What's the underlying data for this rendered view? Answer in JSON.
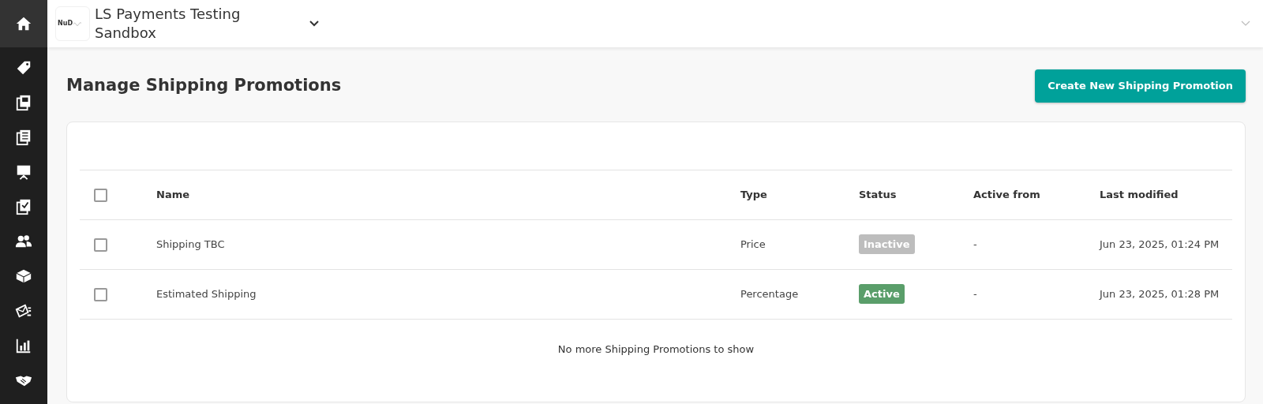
{
  "sidebar": {
    "items": [
      {
        "selected": true
      },
      {
        "selected": false
      },
      {
        "selected": false
      },
      {
        "selected": false
      },
      {
        "selected": false
      },
      {
        "selected": false
      },
      {
        "selected": false
      },
      {
        "selected": false
      },
      {
        "selected": false
      },
      {
        "selected": false
      },
      {
        "selected": false
      }
    ]
  },
  "header": {
    "logo_text": "NuD",
    "store_name": "LS Payments Testing Sandbox"
  },
  "page": {
    "title": "Manage Shipping Promotions",
    "create_button": "Create New Shipping Promotion"
  },
  "table": {
    "select_all_checked": false,
    "columns": [
      "Name",
      "Type",
      "Status",
      "Active from",
      "Last modified"
    ],
    "rows": [
      {
        "checked": false,
        "name": "Shipping TBC",
        "type": "Price",
        "status": "Inactive",
        "active": false,
        "active_from": "-",
        "last_modified": "Jun 23, 2025, 01:24 PM"
      },
      {
        "checked": false,
        "name": "Estimated Shipping",
        "type": "Percentage",
        "status": "Active",
        "active": true,
        "active_from": "-",
        "last_modified": "Jun 23, 2025, 01:28 PM"
      }
    ],
    "footer": "No more Shipping Promotions to show"
  }
}
